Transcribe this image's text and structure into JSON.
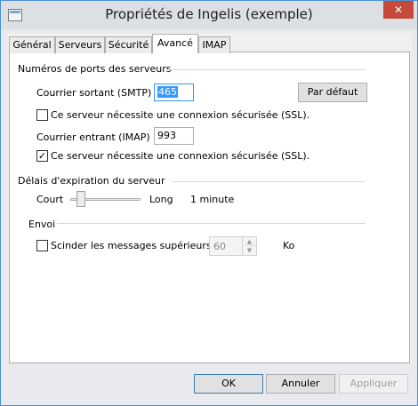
{
  "window": {
    "title": "Propriétés de Ingelis (exemple)",
    "close_glyph": "✕"
  },
  "tabs": [
    {
      "label": "Général"
    },
    {
      "label": "Serveurs"
    },
    {
      "label": "Sécurité"
    },
    {
      "label": "Avancé"
    },
    {
      "label": "IMAP"
    }
  ],
  "active_tab": "Avancé",
  "ports": {
    "heading": "Numéros de ports des serveurs",
    "smtp_label": "Courrier sortant (SMTP) :",
    "smtp_value": "465",
    "default_button": "Par défaut",
    "smtp_ssl_label": "Ce serveur nécessite une connexion sécurisée (SSL).",
    "smtp_ssl_checked": false,
    "imap_label": "Courrier entrant (IMAP) :",
    "imap_value": "993",
    "imap_ssl_label": "Ce serveur nécessite une connexion sécurisée (SSL).",
    "imap_ssl_checked": true,
    "check_glyph": "✓"
  },
  "timeout": {
    "heading": "Délais d'expiration du serveur",
    "short_label": "Court",
    "long_label": "Long",
    "value_text": "1 minute",
    "slider_level": 0.1
  },
  "send": {
    "heading": "Envoi",
    "split_label": "Scinder les messages supérieurs à",
    "split_checked": false,
    "split_value": "60",
    "unit": "Ko",
    "spin_up_glyph": "▲",
    "spin_down_glyph": "▼"
  },
  "footer": {
    "ok": "OK",
    "cancel": "Annuler",
    "apply": "Appliquer"
  },
  "colors": {
    "selection": "#3399ff",
    "close_button": "#c7493c",
    "window_border": "#4a8fd4"
  }
}
